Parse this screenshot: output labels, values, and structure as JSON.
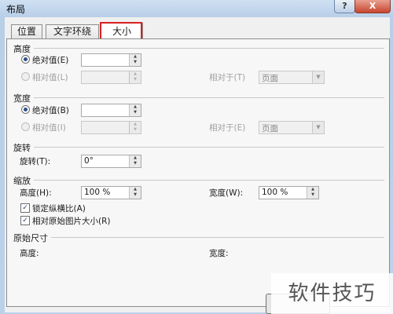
{
  "window": {
    "title": "布局",
    "help_label": "?",
    "close_label": "X"
  },
  "tabs": [
    {
      "label": "位置"
    },
    {
      "label": "文字环绕"
    },
    {
      "label": "大小"
    }
  ],
  "height": {
    "section": "高度",
    "absolute_label": "绝对值(E)",
    "absolute_value": "",
    "relative_label": "相对值(L)",
    "relative_value": "",
    "relative_to_label": "相对于(T)",
    "relative_to_value": "页面"
  },
  "width": {
    "section": "宽度",
    "absolute_label": "绝对值(B)",
    "absolute_value": "",
    "relative_label": "相对值(I)",
    "relative_value": "",
    "relative_to_label": "相对于(E)",
    "relative_to_value": "页面"
  },
  "rotate": {
    "section": "旋转",
    "label": "旋转(T):",
    "value": "0°"
  },
  "scale": {
    "section": "缩放",
    "height_label": "高度(H):",
    "height_value": "100 %",
    "width_label": "宽度(W):",
    "width_value": "100 %",
    "lock_label": "锁定纵横比(A)",
    "lock_checked": true,
    "relative_label": "相对原始图片大小(R)",
    "relative_checked": true
  },
  "original": {
    "section": "原始尺寸",
    "height_label": "高度:",
    "width_label": "宽度:"
  },
  "watermark": "软件技巧"
}
